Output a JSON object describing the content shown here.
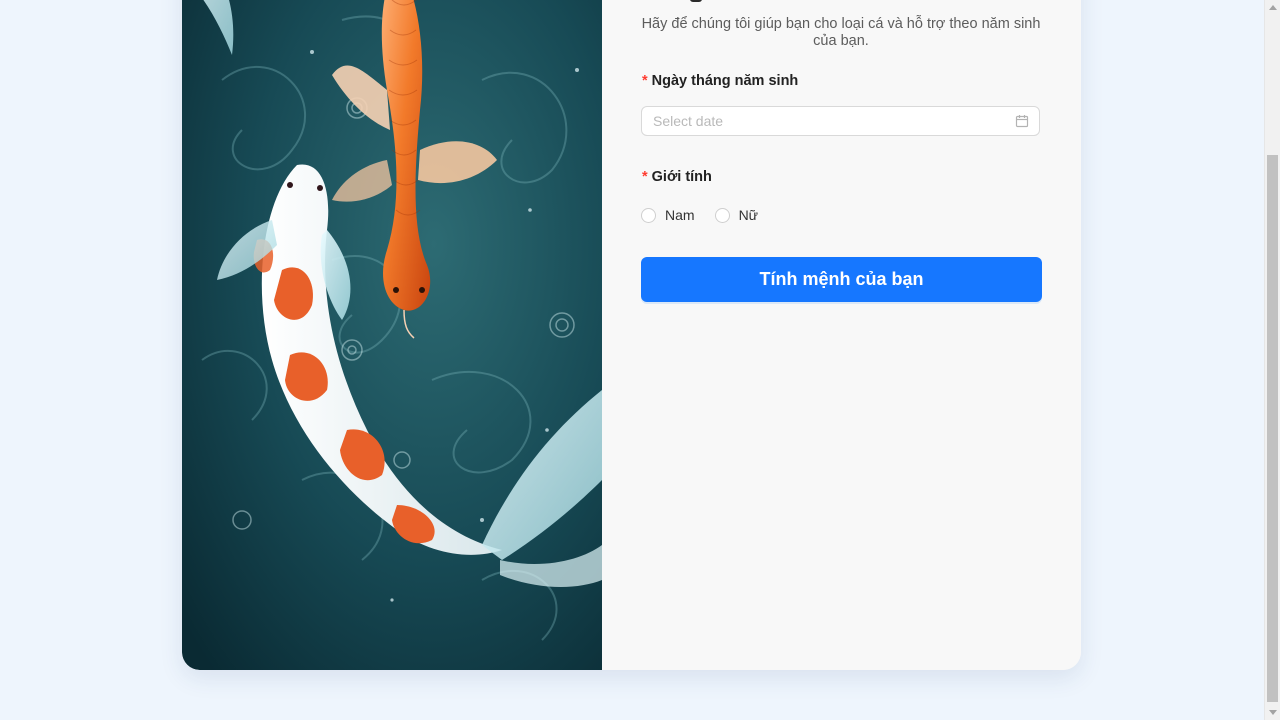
{
  "form": {
    "subtitle": "Hãy để chúng tôi giúp bạn cho loại cá và hỗ trợ theo năm sinh của bạn.",
    "dob": {
      "required_mark": "*",
      "label": "Ngày tháng năm sinh",
      "placeholder": "Select date",
      "icon": "calendar-icon"
    },
    "gender": {
      "required_mark": "*",
      "label": "Giới tính",
      "options": [
        "Nam",
        "Nữ"
      ]
    },
    "submit_label": "Tính mệnh của bạn"
  },
  "colors": {
    "page_background": "#eef5fd",
    "card_background": "#f8f8f8",
    "primary": "#1677ff",
    "required": "#ff3b30",
    "art_water": "#0f3a45"
  }
}
